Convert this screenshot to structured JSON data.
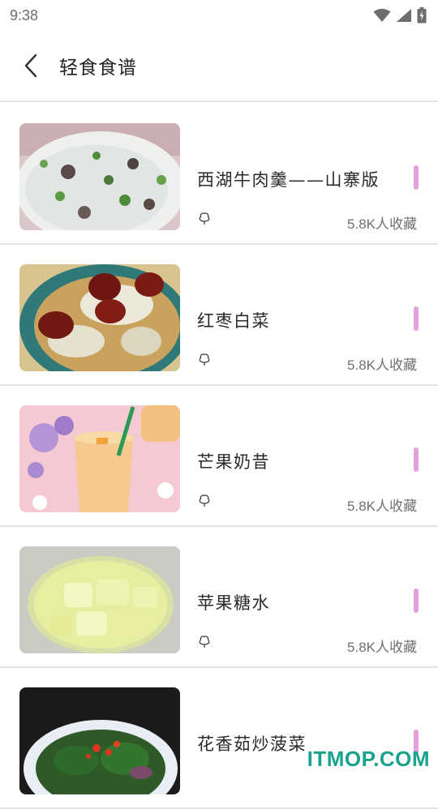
{
  "status_bar": {
    "time": "9:38"
  },
  "toolbar": {
    "title": "轻食食谱"
  },
  "items": [
    {
      "title": "西湖牛肉羹——山寨版",
      "favorites": "5.8K人收藏"
    },
    {
      "title": "红枣白菜",
      "favorites": "5.8K人收藏"
    },
    {
      "title": "芒果奶昔",
      "favorites": "5.8K人收藏"
    },
    {
      "title": "苹果糖水",
      "favorites": "5.8K人收藏"
    },
    {
      "title": "花香茹炒菠菜",
      "favorites": ""
    }
  ],
  "colors": {
    "accent": "#e2a1dc",
    "watermark": "#1aa38c"
  },
  "watermark": "ITMOP.COM"
}
